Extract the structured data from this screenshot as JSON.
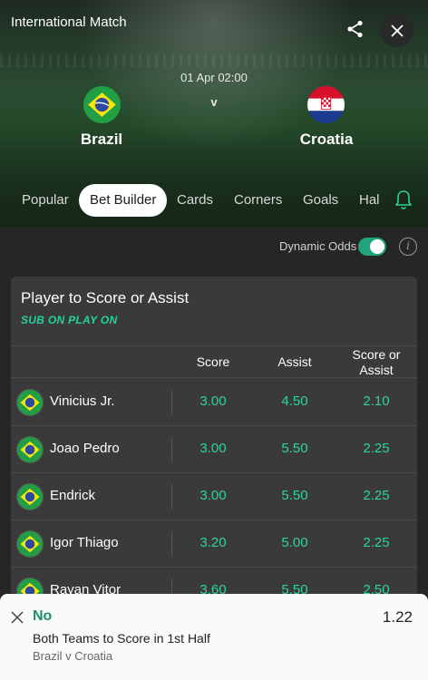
{
  "header": {
    "competition": "International Match",
    "date_time": "01 Apr 02:00",
    "vs": "v",
    "home_team": "Brazil",
    "away_team": "Croatia"
  },
  "tabs": [
    {
      "label": "Popular",
      "active": false
    },
    {
      "label": "Bet Builder",
      "active": true
    },
    {
      "label": "Cards",
      "active": false
    },
    {
      "label": "Corners",
      "active": false
    },
    {
      "label": "Goals",
      "active": false
    },
    {
      "label": "Hal",
      "active": false
    }
  ],
  "dynamic_odds": {
    "label": "Dynamic Odds",
    "enabled": true
  },
  "market": {
    "title": "Player to Score or Assist",
    "subtitle": "SUB ON PLAY ON",
    "columns": [
      "Score",
      "Assist",
      "Score or Assist"
    ],
    "rows": [
      {
        "player": "Vinicius Jr.",
        "score": "3.00",
        "assist": "4.50",
        "score_or_assist": "2.10"
      },
      {
        "player": "Joao Pedro",
        "score": "3.00",
        "assist": "5.50",
        "score_or_assist": "2.25"
      },
      {
        "player": "Endrick",
        "score": "3.00",
        "assist": "5.50",
        "score_or_assist": "2.25"
      },
      {
        "player": "Igor Thiago",
        "score": "3.20",
        "assist": "5.00",
        "score_or_assist": "2.25"
      },
      {
        "player": "Rayan Vitor",
        "score": "3.60",
        "assist": "5.50",
        "score_or_assist": "2.50"
      }
    ]
  },
  "bet_slip": {
    "selection": "No",
    "odds": "1.22",
    "market": "Both Teams to Score in 1st Half",
    "event": "Brazil v Croatia"
  },
  "colors": {
    "accent_green": "#2fd39e",
    "toggle_on": "#20a47c",
    "background": "#262626",
    "card": "#3a3a3a"
  },
  "icons": [
    "share-icon",
    "close-icon",
    "bell-icon",
    "info-icon",
    "brazil-flag-icon",
    "croatia-flag-icon"
  ]
}
